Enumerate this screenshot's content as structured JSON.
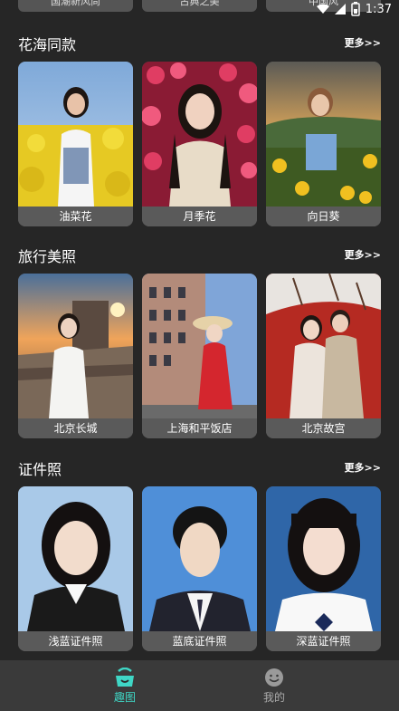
{
  "status_bar": {
    "time": "1:37"
  },
  "top_row": [
    "国潮新风尚",
    "古典之美",
    "中国风"
  ],
  "sections": [
    {
      "title": "花海同款",
      "more": "更多>>",
      "cards": [
        "油菜花",
        "月季花",
        "向日葵"
      ]
    },
    {
      "title": "旅行美照",
      "more": "更多>>",
      "cards": [
        "北京长城",
        "上海和平饭店",
        "北京故宫"
      ]
    },
    {
      "title": "证件照",
      "more": "更多>>",
      "cards": [
        "浅蓝证件照",
        "蓝底证件照",
        "深蓝证件照"
      ]
    }
  ],
  "tabbar": {
    "home_label": "趣图",
    "me_label": "我的"
  },
  "colors": {
    "accent": "#3fd7c6",
    "background": "#262626",
    "tabbar": "#3a3a3a"
  }
}
